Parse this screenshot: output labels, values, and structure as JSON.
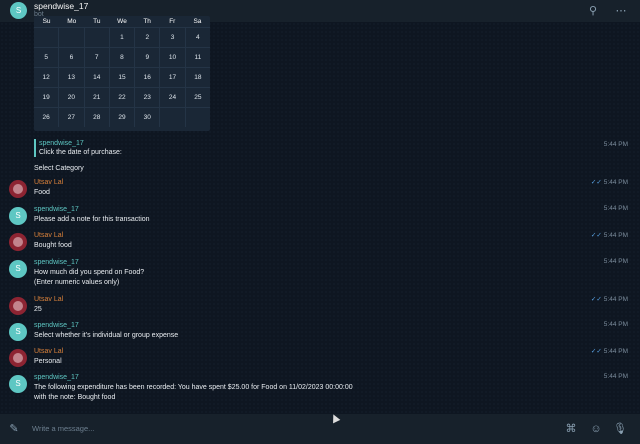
{
  "header": {
    "avatar_letter": "S",
    "title": "spendwise_17",
    "subtitle": "bot",
    "search_icon": "search-icon",
    "menu_icon": "more-icon"
  },
  "calendar": {
    "weekdays": [
      "Su",
      "Mo",
      "Tu",
      "We",
      "Th",
      "Fr",
      "Sa"
    ],
    "weeks": [
      [
        "",
        "",
        "",
        "1",
        "2",
        "3",
        "4"
      ],
      [
        "5",
        "6",
        "7",
        "8",
        "9",
        "10",
        "11"
      ],
      [
        "12",
        "13",
        "14",
        "15",
        "16",
        "17",
        "18"
      ],
      [
        "19",
        "20",
        "21",
        "22",
        "23",
        "24",
        "25"
      ],
      [
        "26",
        "27",
        "28",
        "29",
        "30",
        "",
        ""
      ]
    ]
  },
  "quote": {
    "name": "spendwise_17",
    "text": "Click the date of purchase:",
    "time": "5:44 PM"
  },
  "select_category": "Select Category",
  "messages": [
    {
      "sender": "Utsav Lal",
      "role": "user",
      "text": "Food",
      "time": "5:44 PM"
    },
    {
      "sender": "spendwise_17",
      "role": "bot",
      "text": "Please add a note for this transaction",
      "time": "5:44 PM"
    },
    {
      "sender": "Utsav Lal",
      "role": "user",
      "text": "Bought food",
      "time": "5:44 PM"
    },
    {
      "sender": "spendwise_17",
      "role": "bot",
      "text": "How much did you spend on Food?\n(Enter numeric values only)",
      "time": "5:44 PM"
    },
    {
      "sender": "Utsav Lal",
      "role": "user",
      "text": "25",
      "time": "5:44 PM"
    },
    {
      "sender": "spendwise_17",
      "role": "bot",
      "text": "Select whether it's individual or group expense",
      "time": "5:44 PM"
    },
    {
      "sender": "Utsav Lal",
      "role": "user",
      "text": "Personal",
      "time": "5:44 PM"
    },
    {
      "sender": "spendwise_17",
      "role": "bot",
      "text": "The following expenditure has been recorded: You have spent $25.00 for Food on 11/02/2023 00:00:00\nwith the note: Bought food",
      "time": "5:44 PM"
    }
  ],
  "composer": {
    "placeholder": "Write a message...",
    "attach_icon": "paperclip-icon",
    "commands_icon": "commands-icon",
    "emoji_icon": "emoji-icon",
    "mic_icon": "microphone-icon"
  },
  "colors": {
    "accent": "#5ec7c3",
    "user_name": "#d9813b",
    "background": "#0e1621",
    "panel": "#17212b"
  }
}
